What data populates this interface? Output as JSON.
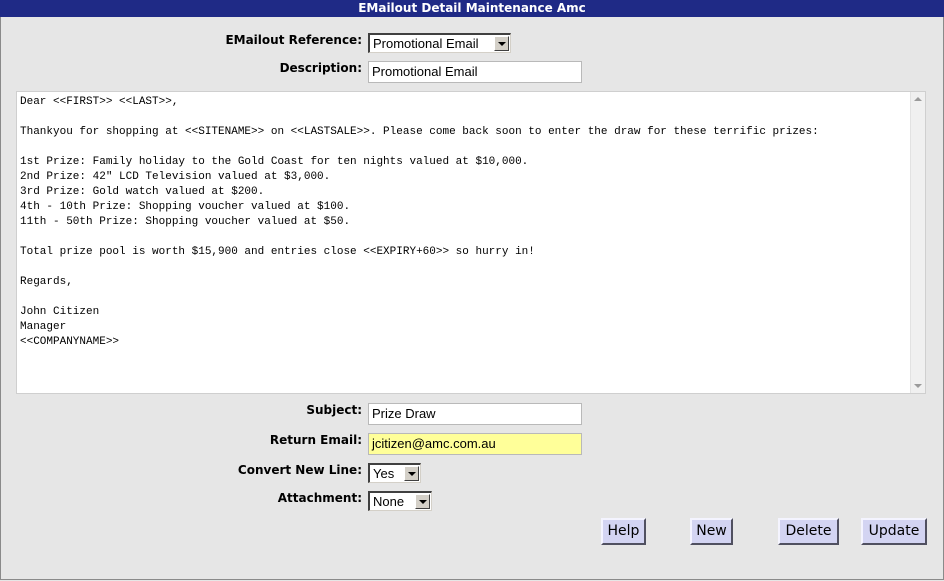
{
  "window": {
    "title": "EMailout Detail Maintenance Amc"
  },
  "form": {
    "reference": {
      "label": "EMailout Reference:",
      "value": "Promotional Email"
    },
    "description": {
      "label": "Description:",
      "value": "Promotional Email"
    },
    "body_text": "Dear <<FIRST>> <<LAST>>,\n\nThankyou for shopping at <<SITENAME>> on <<LASTSALE>>. Please come back soon to enter the draw for these terrific prizes:\n\n1st Prize: Family holiday to the Gold Coast for ten nights valued at $10,000.\n2nd Prize: 42\" LCD Television valued at $3,000.\n3rd Prize: Gold watch valued at $200.\n4th - 10th Prize: Shopping voucher valued at $100.\n11th - 50th Prize: Shopping voucher valued at $50.\n\nTotal prize pool is worth $15,900 and entries close <<EXPIRY+60>> so hurry in!\n\nRegards,\n\nJohn Citizen\nManager\n<<COMPANYNAME>>",
    "subject": {
      "label": "Subject:",
      "value": "Prize Draw"
    },
    "return_email": {
      "label": "Return Email:",
      "value": "jcitizen@amc.com.au",
      "highlight": "#ffff99"
    },
    "convert_new_line": {
      "label": "Convert New Line:",
      "value": "Yes"
    },
    "attachment": {
      "label": "Attachment:",
      "value": "None"
    }
  },
  "buttons": {
    "help": "Help",
    "new": "New",
    "delete": "Delete",
    "update": "Update"
  },
  "colors": {
    "titlebar": "#1f2a86",
    "background": "#e6e6e6",
    "button": "#d3d4f2"
  }
}
